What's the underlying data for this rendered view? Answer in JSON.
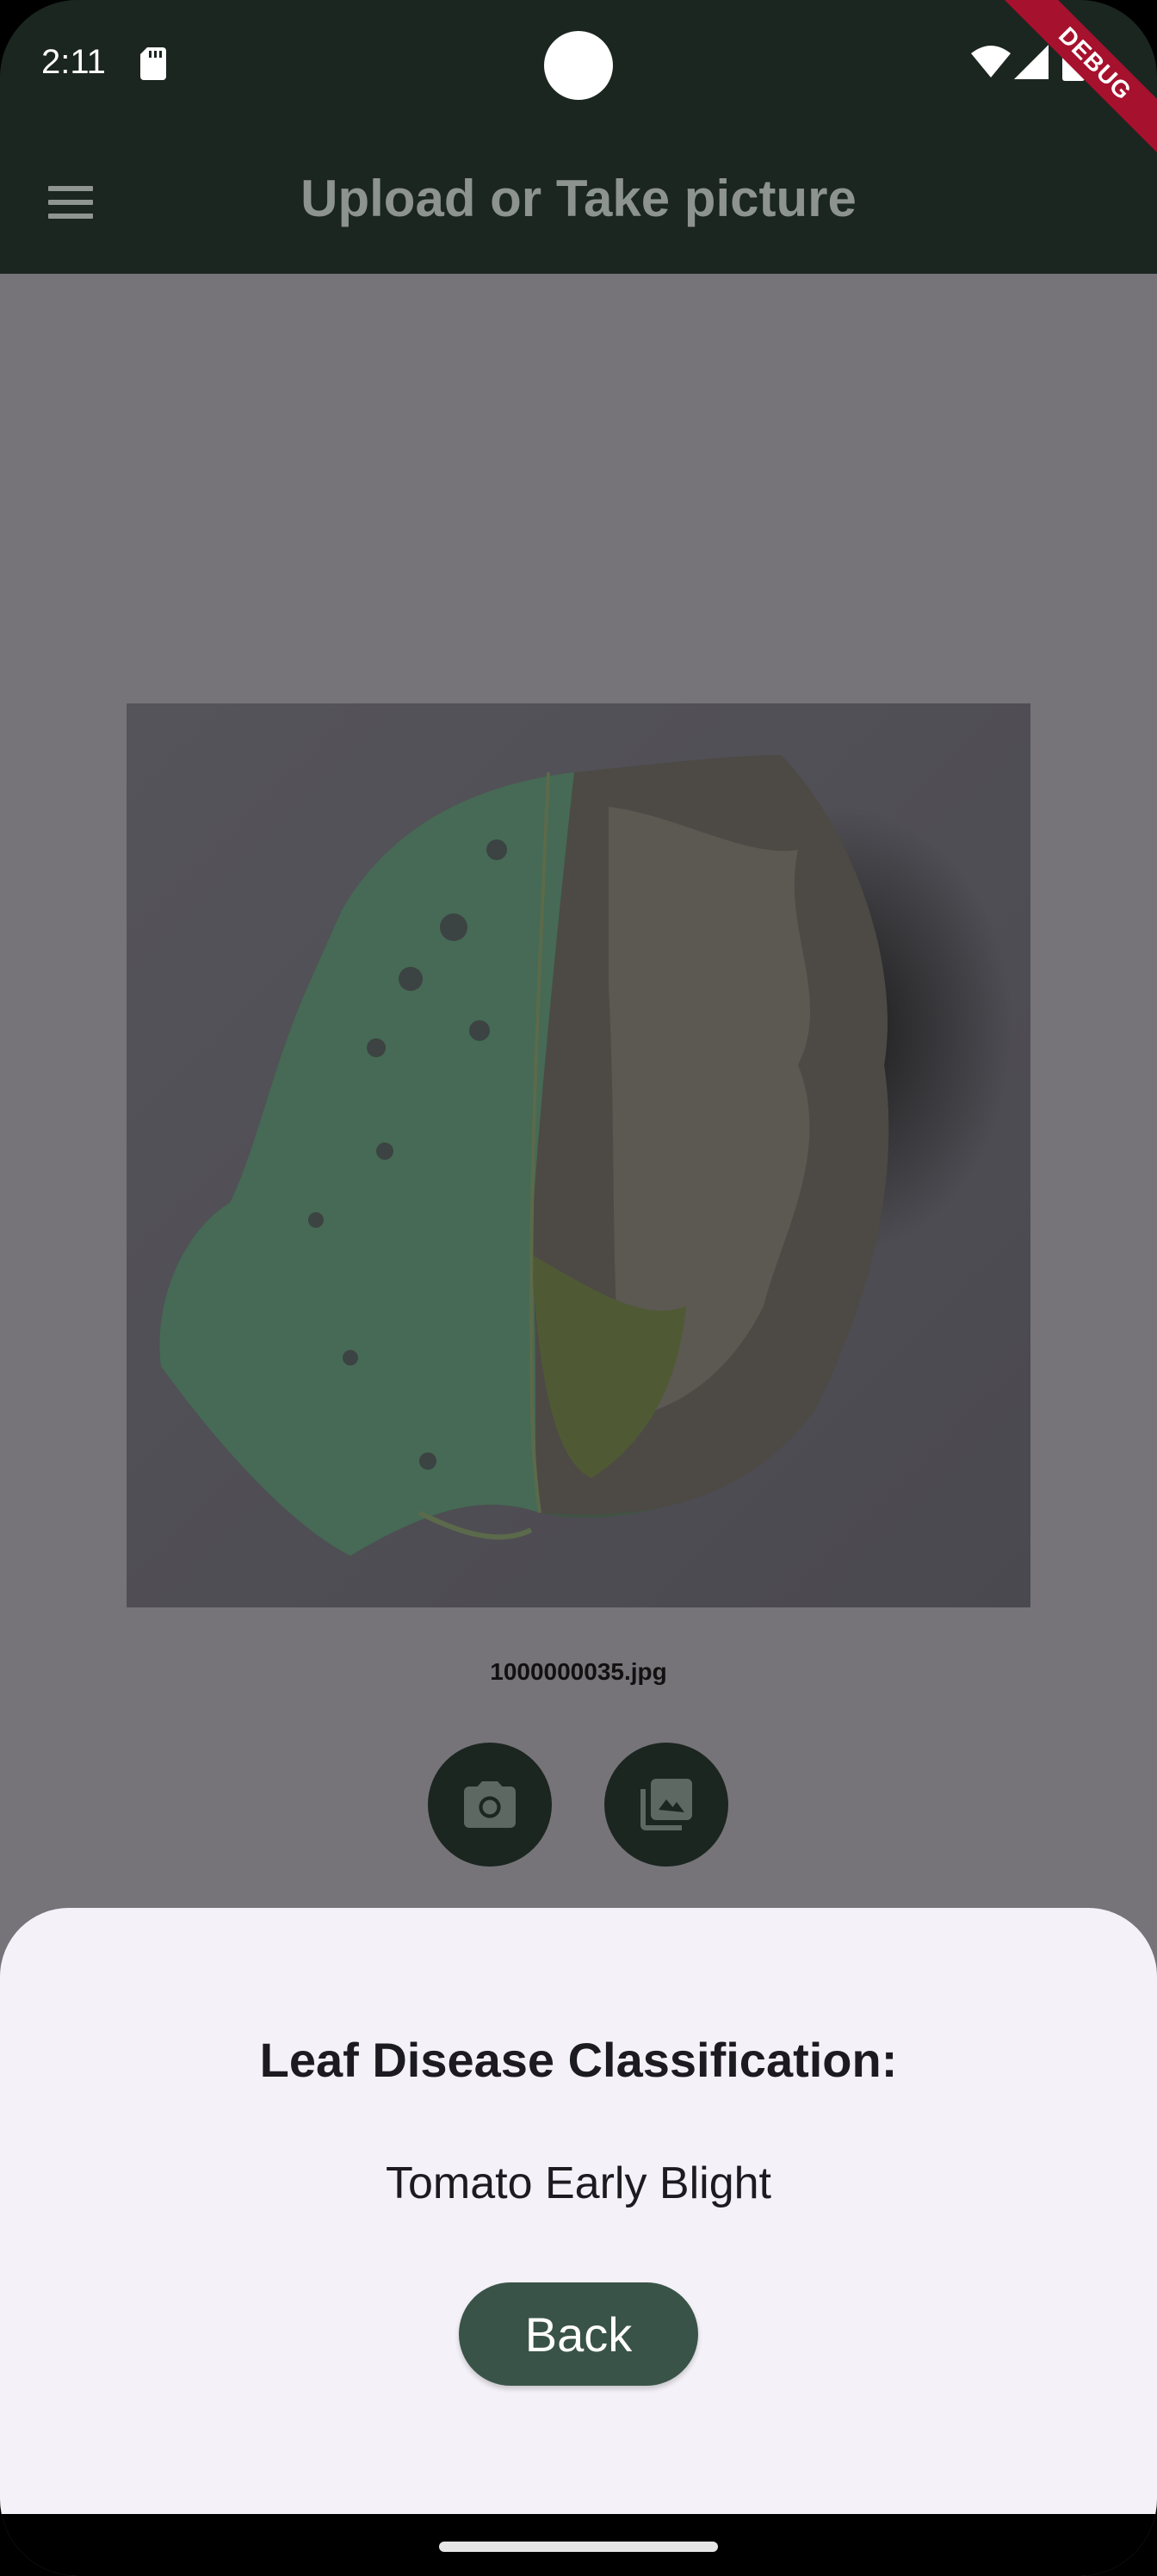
{
  "status_bar": {
    "time": "2:11",
    "icons": [
      "sd-card-icon",
      "wifi-icon",
      "signal-icon",
      "battery-icon"
    ]
  },
  "app_bar": {
    "title": "Upload or Take picture",
    "menu_icon": "hamburger-menu-icon"
  },
  "main": {
    "image_caption": "1000000035.jpg",
    "camera_button_icon": "camera-icon",
    "gallery_button_icon": "photo-library-icon"
  },
  "bottom_sheet": {
    "title": "Leaf Disease Classification:",
    "result": "Tomato Early Blight",
    "back_label": "Back"
  },
  "debug_banner": "DEBUG",
  "colors": {
    "app_bar_bg": "#1b2620",
    "scrim_content_bg": "#767479",
    "sheet_bg": "#f4f2f8",
    "back_button_bg": "#3a5348",
    "debug_ribbon": "#a6112d"
  }
}
